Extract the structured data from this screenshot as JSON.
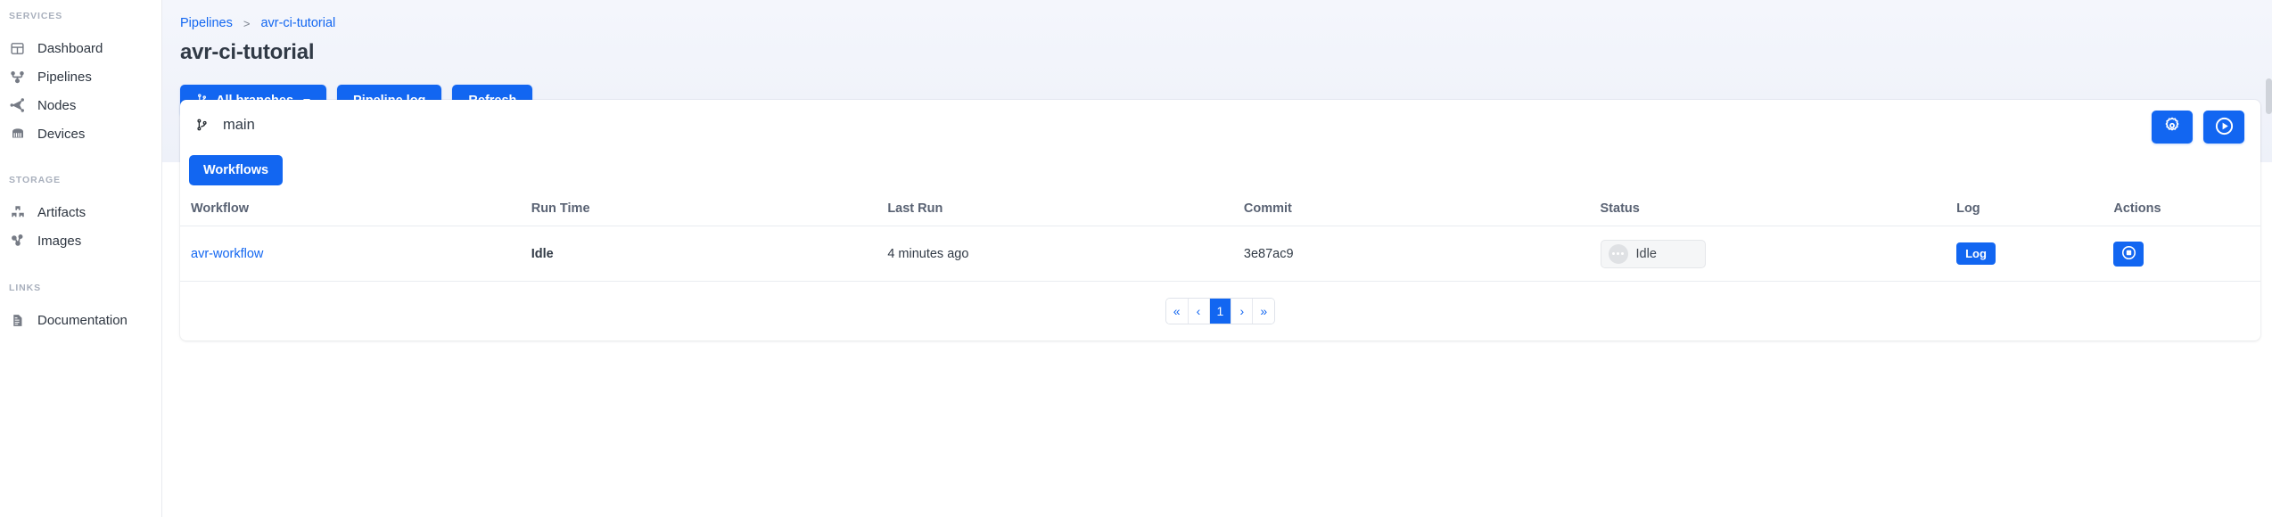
{
  "sidebar": {
    "sections": [
      {
        "label": "SERVICES"
      },
      {
        "label": "STORAGE"
      },
      {
        "label": "LINKS"
      }
    ],
    "items": [
      {
        "label": "Dashboard",
        "icon": "dashboard-grid-icon"
      },
      {
        "label": "Pipelines",
        "icon": "pipeline-branch-icon"
      },
      {
        "label": "Nodes",
        "icon": "nodes-share-icon"
      },
      {
        "label": "Devices",
        "icon": "devices-rack-icon"
      },
      {
        "label": "Artifacts",
        "icon": "artifacts-boxes-icon"
      },
      {
        "label": "Images",
        "icon": "images-cube-icon"
      },
      {
        "label": "Documentation",
        "icon": "document-icon"
      }
    ]
  },
  "header": {
    "breadcrumb": {
      "root": "Pipelines",
      "separator": ">",
      "current": "avr-ci-tutorial"
    },
    "title": "avr-ci-tutorial",
    "toolbar": {
      "all_branches": "All branches",
      "pipeline_log": "Pipeline log",
      "refresh": "Refresh"
    }
  },
  "card": {
    "branch": "main",
    "actions": {
      "settings": "settings-gear",
      "run": "run-play"
    },
    "tabs": [
      {
        "label": "Workflows",
        "active": true
      }
    ],
    "table": {
      "columns": [
        "Workflow",
        "Run Time",
        "Last Run",
        "Commit",
        "Status",
        "Log",
        "Actions"
      ],
      "rows": [
        {
          "workflow": "avr-workflow",
          "run_time": "Idle",
          "last_run": "4 minutes ago",
          "commit": "3e87ac9",
          "status": "Idle",
          "log_label": "Log",
          "action": "stop-button"
        }
      ]
    },
    "pagination": {
      "first": "«",
      "prev": "‹",
      "pages": [
        "1"
      ],
      "next": "›",
      "last": "»",
      "current": "1"
    }
  },
  "colors": {
    "accent": "#1266f1",
    "link": "#1266f1",
    "header_bg": "#eef1f9",
    "text": "#313a46",
    "muted": "#a9b0bd",
    "badge_bg": "#f5f6f7"
  }
}
